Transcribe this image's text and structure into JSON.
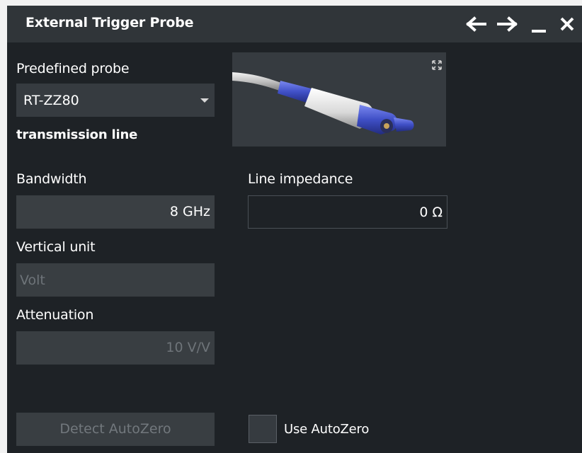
{
  "dialog": {
    "title": "External Trigger Probe",
    "controls": [
      "arrow-left-icon",
      "arrow-right-icon",
      "minimize-icon",
      "close-icon"
    ]
  },
  "probe": {
    "predefined_label": "Predefined probe",
    "predefined_value": "RT-ZZ80",
    "type_label": "transmission line"
  },
  "bandwidth": {
    "label": "Bandwidth",
    "value": "8 GHz"
  },
  "line_impedance": {
    "label": "Line impedance",
    "value": "0 Ω"
  },
  "vertical_unit": {
    "label": "Vertical unit",
    "value": "Volt"
  },
  "attenuation": {
    "label": "Attenuation",
    "value": "10 V/V"
  },
  "autozero": {
    "detect_label": "Detect AutoZero",
    "use_label": "Use AutoZero",
    "use_checked": false
  },
  "colors": {
    "background": "#1e2226",
    "titlebar": "#303539",
    "field": "#3a3f43",
    "disabled_text": "#6e7479",
    "probe_blue": "#4a5bd0"
  }
}
